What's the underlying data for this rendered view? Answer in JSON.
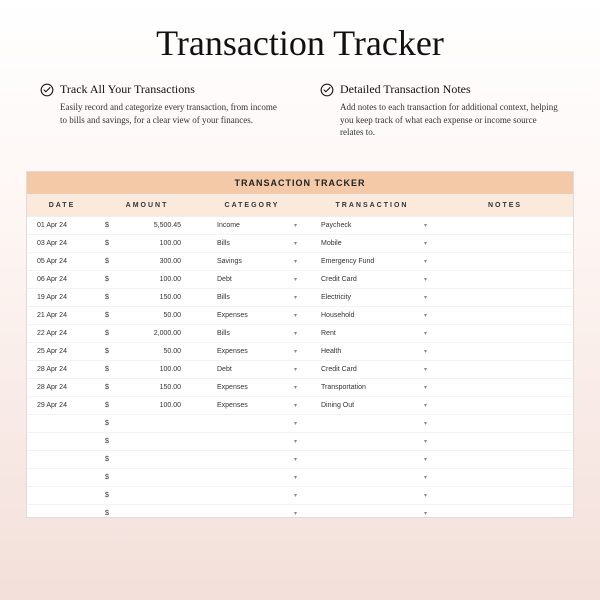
{
  "title": "Transaction Tracker",
  "features": [
    {
      "title": "Track All Your Transactions",
      "desc": "Easily record and categorize every transaction, from income to bills and savings, for a clear view of your finances."
    },
    {
      "title": "Detailed Transaction Notes",
      "desc": "Add notes to each transaction for additional context, helping you keep track of what each expense or income source relates to."
    }
  ],
  "sheet": {
    "title": "TRANSACTION TRACKER",
    "columns": [
      "DATE",
      "AMOUNT",
      "CATEGORY",
      "TRANSACTION",
      "NOTES"
    ],
    "currency": "$",
    "rows": [
      {
        "date": "01 Apr 24",
        "amount": "5,500.45",
        "category": "Income",
        "transaction": "Paycheck",
        "notes": ""
      },
      {
        "date": "03 Apr 24",
        "amount": "100.00",
        "category": "Bills",
        "transaction": "Mobile",
        "notes": ""
      },
      {
        "date": "05 Apr 24",
        "amount": "300.00",
        "category": "Savings",
        "transaction": "Emergency Fund",
        "notes": ""
      },
      {
        "date": "06 Apr 24",
        "amount": "100.00",
        "category": "Debt",
        "transaction": "Credit Card",
        "notes": ""
      },
      {
        "date": "19 Apr 24",
        "amount": "150.00",
        "category": "Bills",
        "transaction": "Electricity",
        "notes": ""
      },
      {
        "date": "21 Apr 24",
        "amount": "50.00",
        "category": "Expenses",
        "transaction": "Household",
        "notes": ""
      },
      {
        "date": "22 Apr 24",
        "amount": "2,000.00",
        "category": "Bills",
        "transaction": "Rent",
        "notes": ""
      },
      {
        "date": "25 Apr 24",
        "amount": "50.00",
        "category": "Expenses",
        "transaction": "Health",
        "notes": ""
      },
      {
        "date": "28 Apr 24",
        "amount": "100.00",
        "category": "Debt",
        "transaction": "Credit Card",
        "notes": ""
      },
      {
        "date": "28 Apr 24",
        "amount": "150.00",
        "category": "Expenses",
        "transaction": "Transportation",
        "notes": ""
      },
      {
        "date": "29 Apr 24",
        "amount": "100.00",
        "category": "Expenses",
        "transaction": "Dining Out",
        "notes": ""
      },
      {
        "date": "",
        "amount": "",
        "category": "",
        "transaction": "",
        "notes": ""
      },
      {
        "date": "",
        "amount": "",
        "category": "",
        "transaction": "",
        "notes": ""
      },
      {
        "date": "",
        "amount": "",
        "category": "",
        "transaction": "",
        "notes": ""
      },
      {
        "date": "",
        "amount": "",
        "category": "",
        "transaction": "",
        "notes": ""
      },
      {
        "date": "",
        "amount": "",
        "category": "",
        "transaction": "",
        "notes": ""
      },
      {
        "date": "",
        "amount": "",
        "category": "",
        "transaction": "",
        "notes": ""
      },
      {
        "date": "",
        "amount": "",
        "category": "",
        "transaction": "",
        "notes": ""
      }
    ]
  }
}
